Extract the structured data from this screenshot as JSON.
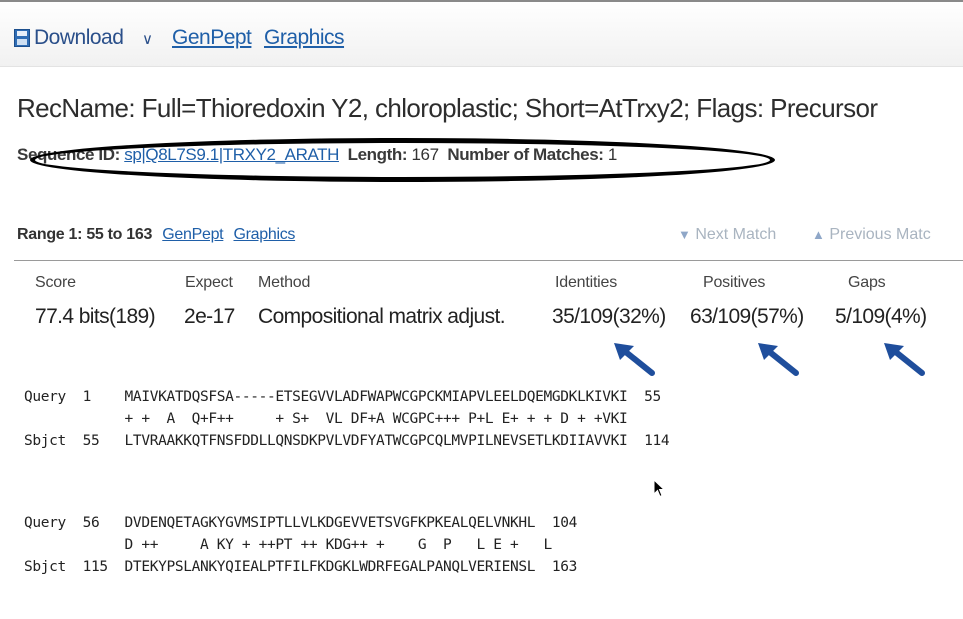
{
  "toolbar": {
    "download_label": "Download",
    "caret": "∨",
    "genpept_link": "GenPept",
    "graphics_link": "Graphics"
  },
  "record": {
    "title": "RecName: Full=Thioredoxin Y2, chloroplastic; Short=AtTrxy2; Flags: Precursor",
    "sequence_id_label": "Sequence ID:",
    "sequence_id_value": "sp|Q8L7S9.1|TRXY2_ARATH",
    "length_label": "Length:",
    "length_value": "167",
    "matches_label": "Number of Matches:",
    "matches_value": "1"
  },
  "range": {
    "label": "Range 1: 55 to 163",
    "genpept_link": "GenPept",
    "graphics_link": "Graphics",
    "next_match": "Next Match",
    "previous_match": "Previous Matc"
  },
  "stats": {
    "headers": [
      "Score",
      "Expect",
      "Method",
      "Identities",
      "Positives",
      "Gaps"
    ],
    "values": [
      "77.4 bits(189)",
      "2e-17",
      "Compositional matrix adjust.",
      "35/109(32%)",
      "63/109(57%)",
      "5/109(4%)"
    ]
  },
  "alignment": {
    "block1": "Query  1    MAIVKATDQSFSA-----ETSEGVVLADFWAPWCGPCKMIAPVLEELDQEMGDKLKIVKI  55\n            + +  A  Q+F++     + S+  VL DF+A WCGPC+++ P+L E+ + + D + +VKI\nSbjct  55   LTVRAAKKQTFNSFDDLLQNSDKPVLVDFYATWCGPCQLMVPILNEVSETLKDIIAVVKI  114",
    "block2": "Query  56   DVDENQETAGKYGVMSIPTLLVLKDGEVVETSVGFKPKEALQELVNKHL  104\n            D ++     A KY + ++PT ++ KDG++ +    G  P   L E +   L\nSbjct  115  DTEKYPSLANKYQIEALPTFILFKDGKLWDRFEGALPANQLVERIENSL  163"
  },
  "colors": {
    "link": "#1f5fa8",
    "annotation_arrow": "#1f4e9c",
    "oval": "#000000"
  }
}
